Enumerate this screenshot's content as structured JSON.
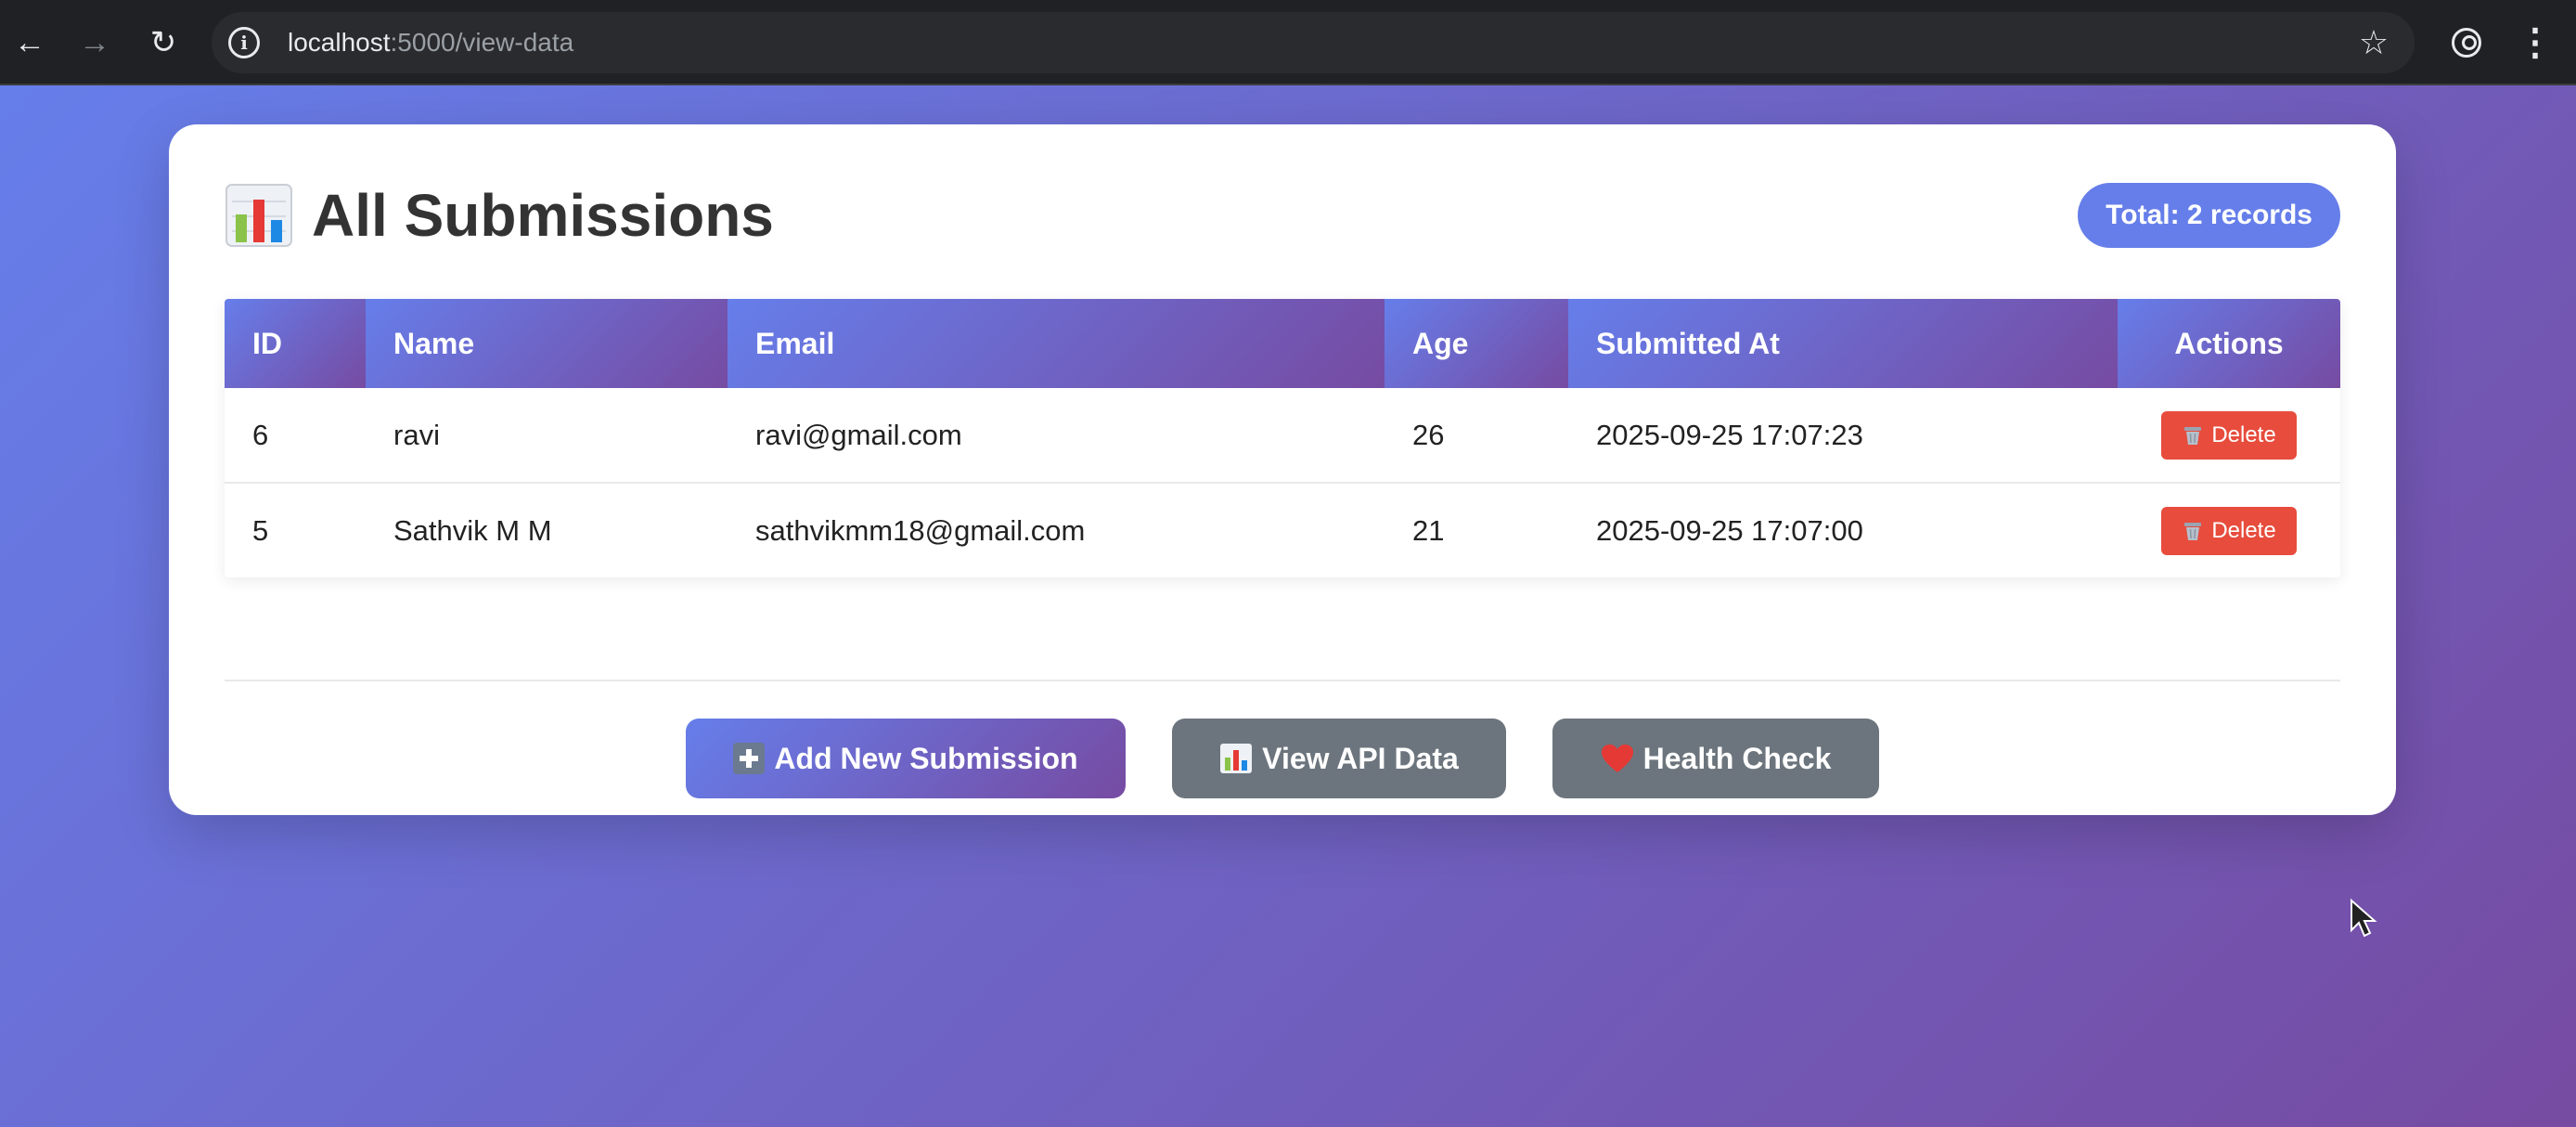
{
  "browser": {
    "url_host": "localhost",
    "url_rest": ":5000/view-data"
  },
  "page": {
    "title": "All Submissions",
    "total_badge": "Total: 2 records",
    "table": {
      "headers": {
        "id": "ID",
        "name": "Name",
        "email": "Email",
        "age": "Age",
        "submitted_at": "Submitted At",
        "actions": "Actions"
      },
      "rows": [
        {
          "id": "6",
          "name": "ravi",
          "email": "ravi@gmail.com",
          "age": "26",
          "submitted_at": "2025-09-25 17:07:23",
          "action": "Delete"
        },
        {
          "id": "5",
          "name": "Sathvik M M",
          "email": "sathvikmm18@gmail.com",
          "age": "21",
          "submitted_at": "2025-09-25 17:07:00",
          "action": "Delete"
        }
      ]
    },
    "buttons": {
      "add": "Add New Submission",
      "api": "View API Data",
      "health": "Health Check"
    }
  },
  "colors": {
    "gradient_start": "#667eea",
    "gradient_end": "#764ba2",
    "delete": "#e74c3c",
    "secondary": "#6c757d"
  }
}
